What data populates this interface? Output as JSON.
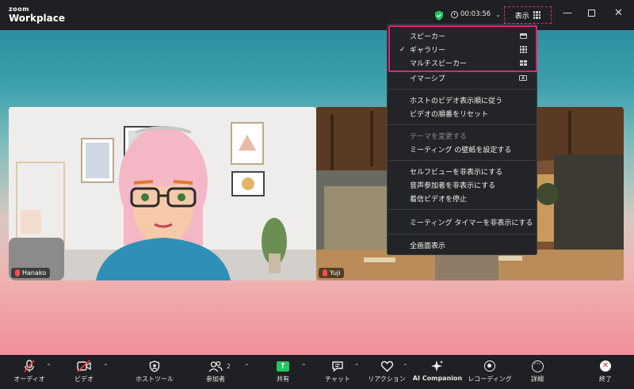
{
  "app": {
    "logo_top": "zoom",
    "logo_bottom": "Workplace"
  },
  "header": {
    "timer": "00:03:56",
    "view_label": "表示"
  },
  "participants": [
    {
      "name": "Hanako"
    },
    {
      "name": "Yuji"
    }
  ],
  "view_menu": {
    "items": [
      {
        "label": "スピーカー",
        "checked": false,
        "icon": "speaker-view-icon"
      },
      {
        "label": "ギャラリー",
        "checked": true,
        "icon": "gallery-grid-icon"
      },
      {
        "label": "マルチスピーカー",
        "checked": false,
        "icon": "multi-speaker-icon"
      },
      {
        "label": "イマーシブ",
        "checked": false,
        "icon": "immersive-icon"
      },
      {
        "label": "ホストのビデオ表示順に従う"
      },
      {
        "label": "ビデオの順番をリセット"
      },
      {
        "label": "テーマを変更する",
        "disabled": true
      },
      {
        "label": "ミーティング の壁紙を設定する"
      },
      {
        "label": "セルフビューを非表示にする"
      },
      {
        "label": "音声参加者を非表示にする"
      },
      {
        "label": "着信ビデオを停止"
      },
      {
        "label": "ミーティング タイマーを非表示にする"
      },
      {
        "label": "全画面表示"
      }
    ],
    "check_mark": "✓"
  },
  "toolbar": {
    "audio": "オーディオ",
    "video": "ビデオ",
    "host_tools": "ホストツール",
    "participants": "参加者",
    "participant_count": "2",
    "share": "共有",
    "chat": "チャット",
    "reactions": "リアクション",
    "ai_companion": "AI Companion",
    "recording": "レコーディング",
    "more": "詳細",
    "end": "終了"
  },
  "colors": {
    "highlight": "#e0257a",
    "share_green": "#22c55e",
    "end_red": "#d32f2f",
    "secure_green": "#22c55e"
  }
}
